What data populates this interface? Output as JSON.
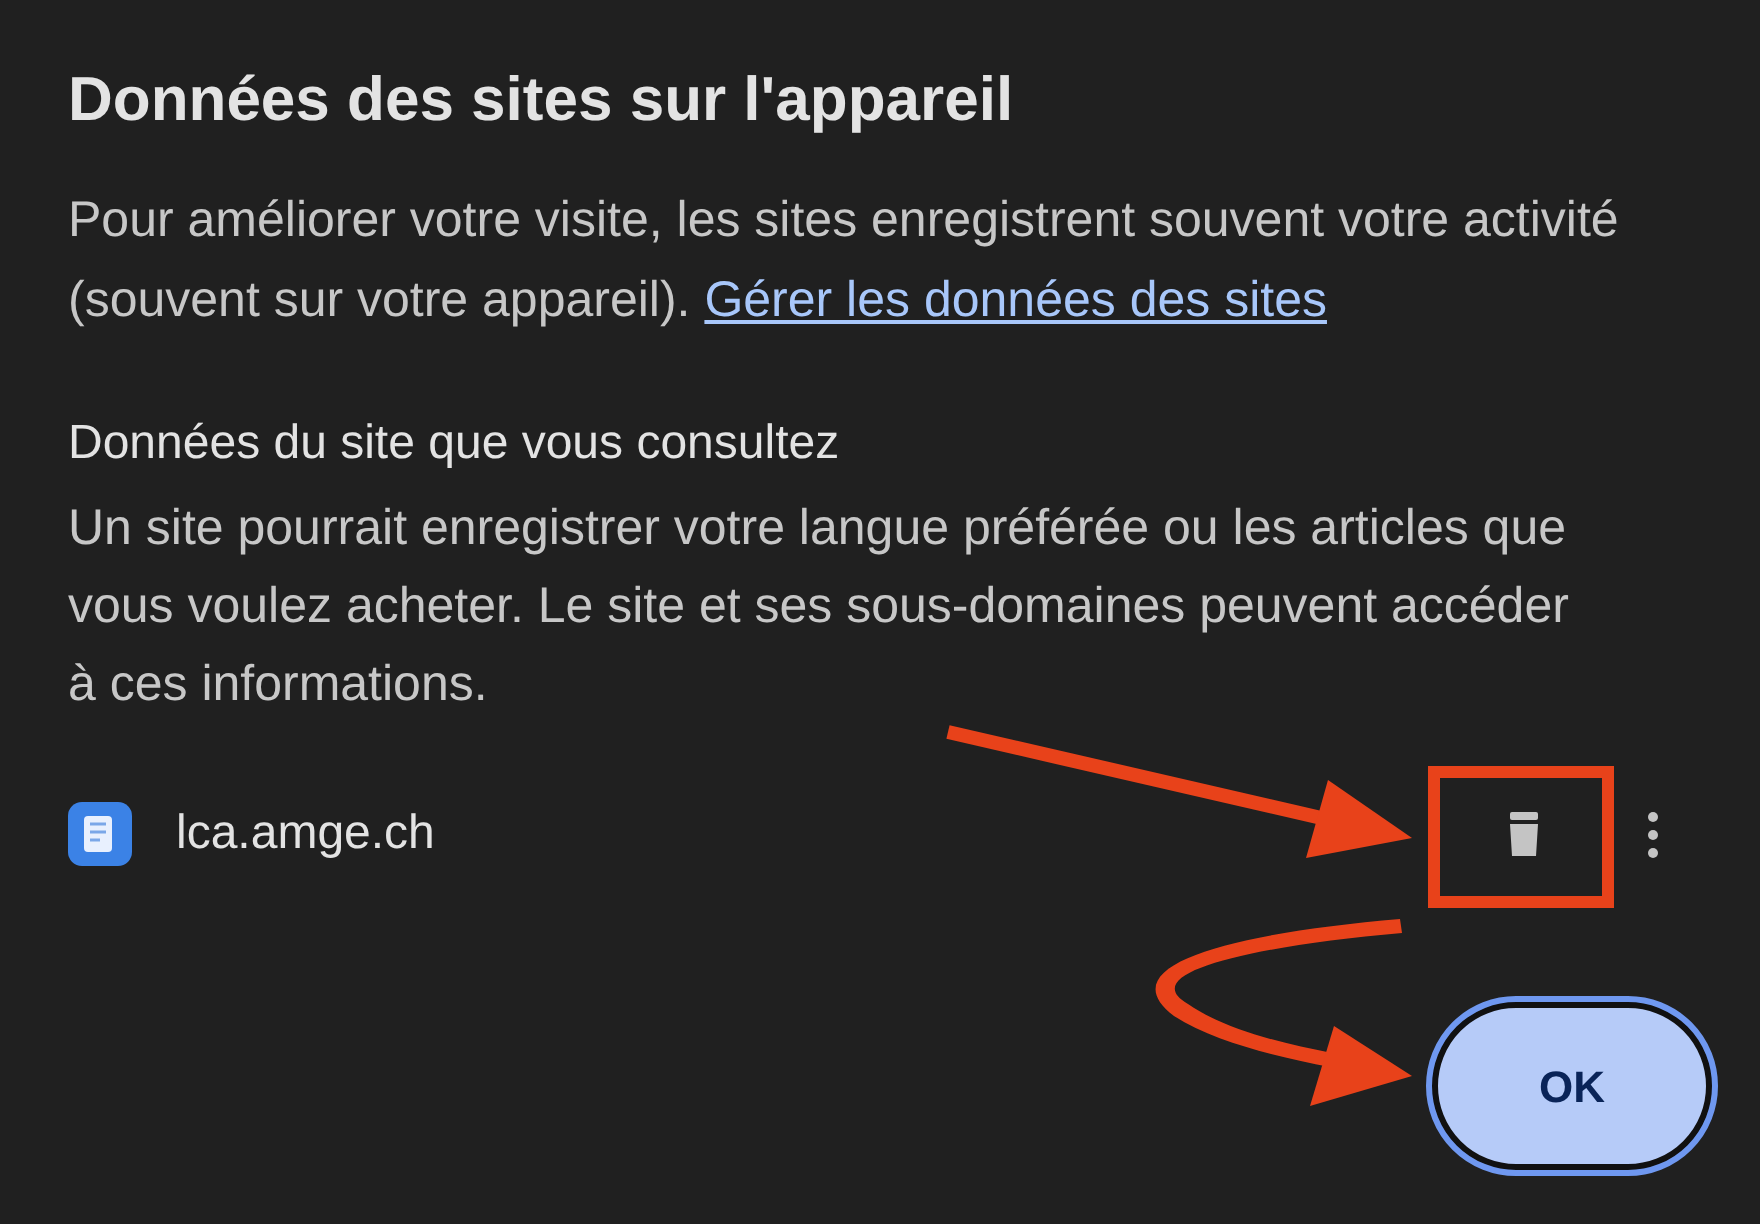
{
  "dialog": {
    "title": "Données des sites sur l'appareil",
    "intro": "Pour améliorer votre visite, les sites enregistrent souvent votre activité (souvent sur votre appareil).",
    "intro_link": "Gérer les données des sites",
    "section_title": "Données du site que vous consultez",
    "section_text": "Un site pourrait enregistrer votre langue préférée ou les articles que vous voulez acheter. Le site et ses sous-domaines peuvent accéder à ces informations.",
    "sites": [
      {
        "domain": "lca.amge.ch"
      }
    ],
    "buttons": [
      {
        "label": "OK",
        "focused": true
      }
    ]
  }
}
